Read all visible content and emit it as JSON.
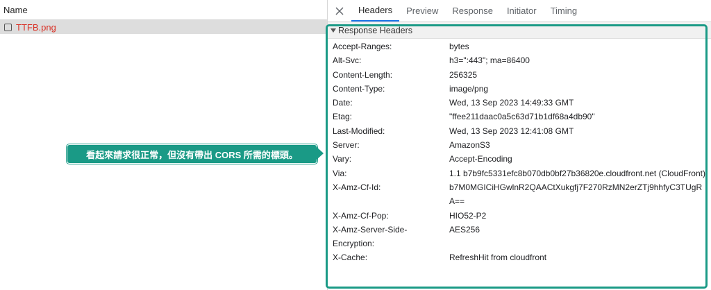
{
  "left_pane": {
    "column_header": "Name",
    "requests": [
      {
        "name": "TTFB.png"
      }
    ]
  },
  "tabs": [
    {
      "label": "Headers",
      "active": true
    },
    {
      "label": "Preview",
      "active": false
    },
    {
      "label": "Response",
      "active": false
    },
    {
      "label": "Initiator",
      "active": false
    },
    {
      "label": "Timing",
      "active": false
    }
  ],
  "section": {
    "title": "Response Headers",
    "headers": [
      {
        "name": "Accept-Ranges:",
        "value": "bytes"
      },
      {
        "name": "Alt-Svc:",
        "value": "h3=\":443\"; ma=86400"
      },
      {
        "name": "Content-Length:",
        "value": "256325"
      },
      {
        "name": "Content-Type:",
        "value": "image/png"
      },
      {
        "name": "Date:",
        "value": "Wed, 13 Sep 2023 14:49:33 GMT"
      },
      {
        "name": "Etag:",
        "value": "\"ffee211daac0a5c63d71b1df68a4db90\""
      },
      {
        "name": "Last-Modified:",
        "value": "Wed, 13 Sep 2023 12:41:08 GMT"
      },
      {
        "name": "Server:",
        "value": "AmazonS3"
      },
      {
        "name": "Vary:",
        "value": "Accept-Encoding"
      },
      {
        "name": "Via:",
        "value": "1.1 b7b9fc5331efc8b070db0bf27b36820e.cloudfront.net (CloudFront)"
      },
      {
        "name": "X-Amz-Cf-Id:",
        "value": "b7M0MGICiHGwlnR2QAACtXukgfj7F270RzMN2erZTj9hhfyC3TUgRA=="
      },
      {
        "name": "X-Amz-Cf-Pop:",
        "value": "HIO52-P2"
      },
      {
        "name": "X-Amz-Server-Side-Encryption:",
        "value": "AES256"
      },
      {
        "name": "X-Cache:",
        "value": "RefreshHit from cloudfront"
      }
    ]
  },
  "annotation": {
    "text": "看起來請求很正常，但沒有帶出 CORS 所需的標頭。"
  },
  "colors": {
    "annotation_bg": "#1a9a86",
    "error_text": "#d93025",
    "active_tab_underline": "#1a73e8"
  }
}
